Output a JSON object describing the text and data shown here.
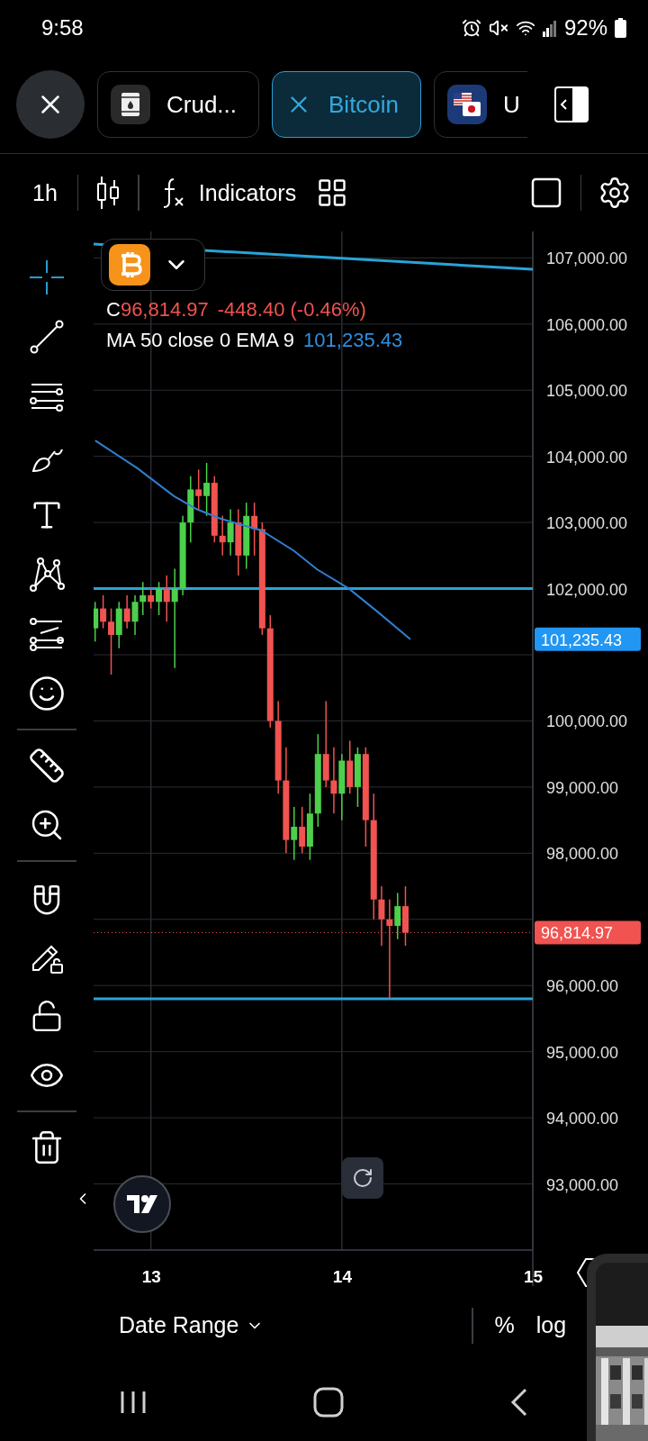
{
  "status_bar": {
    "time": "9:58",
    "battery": "92%"
  },
  "tabs": [
    {
      "label": "Crud...",
      "selected": false,
      "kind": "barrel"
    },
    {
      "label": "Bitcoin",
      "selected": true
    },
    {
      "label": "U",
      "selected": false,
      "kind": "flag"
    }
  ],
  "toolbar": {
    "interval": "1h",
    "indicators": "Indicators"
  },
  "tool_groups": [
    [
      {
        "kind": "crosshair",
        "selected": true
      },
      {
        "kind": "line",
        "selected": false
      },
      {
        "kind": "hlines",
        "selected": false
      },
      {
        "kind": "brush",
        "selected": false
      },
      {
        "kind": "text",
        "selected": false
      },
      {
        "kind": "pattern",
        "selected": false
      },
      {
        "kind": "fib",
        "selected": false
      },
      {
        "kind": "emoji",
        "selected": false
      }
    ],
    [
      {
        "kind": "ruler",
        "selected": false
      },
      {
        "kind": "zoom",
        "selected": false
      }
    ],
    [
      {
        "kind": "magnet",
        "selected": false
      },
      {
        "kind": "pencil-lock",
        "selected": false
      },
      {
        "kind": "lock",
        "selected": false
      },
      {
        "kind": "eye",
        "selected": false
      }
    ],
    [
      {
        "kind": "trash",
        "selected": false
      }
    ]
  ],
  "legend": {
    "close_label": "C",
    "close": "96,814.97",
    "change": "-448.40 (-0.46%)",
    "study": "MA 50 close 0 EMA 9",
    "study_value": "101,235.43"
  },
  "chart": {
    "chart_data": {
      "type": "candlestick",
      "x": [
        12.708,
        12.75,
        12.792,
        12.833,
        12.875,
        12.917,
        12.958,
        13,
        13.042,
        13.083,
        13.125,
        13.167,
        13.208,
        13.25,
        13.292,
        13.333,
        13.375,
        13.417,
        13.458,
        13.5,
        13.542,
        13.583,
        13.625,
        13.667,
        13.708,
        13.75,
        13.792,
        13.833,
        13.875,
        13.917,
        13.958,
        14,
        14.042,
        14.083,
        14.125,
        14.167,
        14.208,
        14.25,
        14.292,
        14.333
      ],
      "ohlc": [
        [
          101400,
          101800,
          101200,
          101700
        ],
        [
          101700,
          101900,
          101400,
          101500
        ],
        [
          101500,
          101700,
          100700,
          101300
        ],
        [
          101300,
          101800,
          101100,
          101700
        ],
        [
          101700,
          101900,
          101400,
          101500
        ],
        [
          101500,
          101900,
          101300,
          101800
        ],
        [
          101800,
          102100,
          101600,
          101900
        ],
        [
          101900,
          102000,
          101700,
          101800
        ],
        [
          101800,
          102100,
          101600,
          102000
        ],
        [
          102000,
          102200,
          101500,
          101800
        ],
        [
          101800,
          102300,
          100800,
          102000
        ],
        [
          102000,
          103100,
          101900,
          103000
        ],
        [
          103000,
          103700,
          102700,
          103500
        ],
        [
          103500,
          103800,
          103200,
          103400
        ],
        [
          103400,
          103900,
          103100,
          103600
        ],
        [
          103600,
          103700,
          102700,
          102800
        ],
        [
          102800,
          103100,
          102500,
          102700
        ],
        [
          102700,
          103200,
          102500,
          103000
        ],
        [
          103000,
          103200,
          102200,
          102500
        ],
        [
          102500,
          103300,
          102300,
          103100
        ],
        [
          103100,
          103300,
          102500,
          102900
        ],
        [
          102900,
          103000,
          101300,
          101400
        ],
        [
          101400,
          101600,
          99900,
          100000
        ],
        [
          100000,
          100300,
          98900,
          99100
        ],
        [
          99100,
          99600,
          98000,
          98200
        ],
        [
          98200,
          98700,
          97900,
          98400
        ],
        [
          98400,
          98700,
          98000,
          98100
        ],
        [
          98100,
          98900,
          97900,
          98600
        ],
        [
          98600,
          99800,
          98400,
          99500
        ],
        [
          99500,
          100300,
          99000,
          99100
        ],
        [
          99100,
          99600,
          98600,
          98900
        ],
        [
          98900,
          99500,
          98500,
          99400
        ],
        [
          99400,
          99700,
          98900,
          99000
        ],
        [
          99000,
          99600,
          98700,
          99500
        ],
        [
          99500,
          99600,
          98100,
          98500
        ],
        [
          98500,
          98900,
          97000,
          97300
        ],
        [
          97300,
          97500,
          96600,
          97000
        ],
        [
          97000,
          97300,
          95800,
          96900
        ],
        [
          96900,
          97400,
          96700,
          97200
        ],
        [
          97200,
          97500,
          96600,
          96800
        ]
      ],
      "xlim": [
        12.7,
        15
      ],
      "ylim": [
        92000,
        107400
      ],
      "xticks": [
        13,
        14,
        15
      ],
      "yticks": [
        {
          "value": 107000,
          "label": "107,000.00"
        },
        {
          "value": 106000,
          "label": "106,000.00"
        },
        {
          "value": 105000,
          "label": "105,000.00"
        },
        {
          "value": 104000,
          "label": "104,000.00"
        },
        {
          "value": 103000,
          "label": "103,000.00"
        },
        {
          "value": 102000,
          "label": "102,000.00"
        },
        {
          "value": 100000,
          "label": "100,000.00"
        },
        {
          "value": 99000,
          "label": "99,000.00"
        },
        {
          "value": 98000,
          "label": "98,000.00"
        },
        {
          "value": 96000,
          "label": "96,000.00"
        },
        {
          "value": 95000,
          "label": "95,000.00"
        },
        {
          "value": 94000,
          "label": "94,000.00"
        },
        {
          "value": 93000,
          "label": "93,000.00"
        }
      ],
      "grid": true,
      "ref_lines": [
        {
          "axis": "y",
          "value": 102000,
          "color": "#29a3d8"
        },
        {
          "axis": "y",
          "value": 95800,
          "color": "#29a3d8"
        },
        {
          "axis": "y",
          "value": 96800,
          "color": "#f05350"
        }
      ]
    },
    "drawings": [
      {
        "kind": "trend-line"
      }
    ],
    "price_badges": [
      {
        "kind": "study",
        "text": "101,235.43",
        "color": "#2196f3"
      },
      {
        "kind": "close",
        "text": "96,814.97",
        "color": "#f05350"
      }
    ]
  },
  "bottom_bar": {
    "date_range": "Date Range",
    "percent": "%",
    "log": "log"
  }
}
